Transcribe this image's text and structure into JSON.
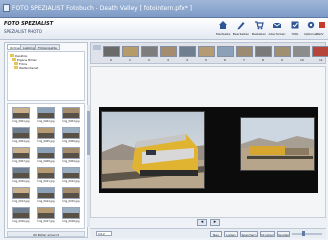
{
  "window": {
    "title": "FOTO SPEZIALIST Fotobuch - Death Valley [ fotointern.pfx* ]"
  },
  "brand": {
    "line1": "FOTO SPEZIALIST",
    "line2": "SPEZIALIST PHOTO"
  },
  "toolbar": {
    "items": [
      {
        "label": "Startseite"
      },
      {
        "label": "Bearbeiten"
      },
      {
        "label": "Bestellen"
      },
      {
        "label": "Abschicken"
      },
      {
        "label": "Hilfe"
      },
      {
        "label": "Optionen"
      },
      {
        "label": "Mehr"
      }
    ]
  },
  "left_tabs": [
    "Ordner",
    "Lieblings",
    "Fotoprojekte"
  ],
  "tree": {
    "items": [
      "Desktop",
      "Eigene Bilder",
      "Fotos",
      "Wetterdienst"
    ]
  },
  "thumbnails": [
    {
      "caption": "Img_0001.jpg"
    },
    {
      "caption": "Img_0002.jpg"
    },
    {
      "caption": "Img_0003.jpg"
    },
    {
      "caption": "Img_0004.jpg"
    },
    {
      "caption": "Img_0005.jpg"
    },
    {
      "caption": "Img_0006.jpg"
    },
    {
      "caption": "Img_0007.jpg"
    },
    {
      "caption": "Img_0008.jpg"
    },
    {
      "caption": "Img_0009.jpg"
    },
    {
      "caption": "Img_0010.jpg"
    },
    {
      "caption": "Img_0011.jpg"
    },
    {
      "caption": "Img_0012.jpg"
    },
    {
      "caption": "Img_0013.jpg"
    },
    {
      "caption": "Img_0014.jpg"
    },
    {
      "caption": "Img_0015.jpg"
    },
    {
      "caption": "Img_0016.jpg"
    },
    {
      "caption": "Img_0017.jpg"
    },
    {
      "caption": "Img_0018.jpg"
    }
  ],
  "left_status": "99 Bilder erkannt",
  "strip": {
    "numbers": [
      "0",
      "1",
      "2",
      "3",
      "4",
      "5",
      "6",
      "7",
      "8",
      "9",
      "10",
      "11"
    ]
  },
  "bottom": {
    "page": "1/12",
    "buttons": [
      "Neu",
      "Laden",
      "Speichern",
      "Drucken",
      "Senden"
    ]
  },
  "colors": {
    "accent": "#5f7aa6",
    "spread_bg": "#0c0c0c"
  }
}
